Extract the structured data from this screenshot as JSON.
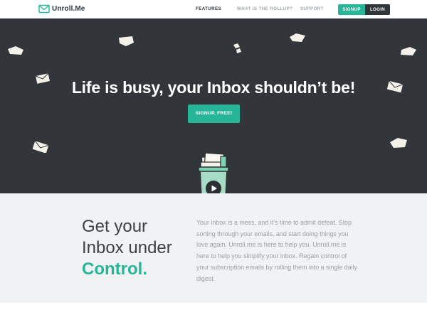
{
  "brand": {
    "name": "Unroll.Me",
    "accent": "#27b598",
    "dark": "#32363a"
  },
  "nav": {
    "features": "FEATURES",
    "rollup": "WHAT IS THE ROLLUP?",
    "support": "SUPPORT",
    "signup": "SIGNUP",
    "login": "LOGIN"
  },
  "hero": {
    "title": "Life is busy, your Inbox shouldn’t be!",
    "cta": "SIGNUP, FREE!"
  },
  "mascot": {
    "icon": "play-icon"
  },
  "intro": {
    "headline_line1": "Get your",
    "headline_line2": "Inbox under",
    "headline_accent": "Control.",
    "body": "Your inbox is a mess, and it’s time to admit defeat. Stop sorting through your emails, and start doing things you love again. Unroll.me is here to help you. Unroll.me is here to help you simplify your inbox. Regain control of your subscription emails by rolling them into a single daily digest."
  }
}
